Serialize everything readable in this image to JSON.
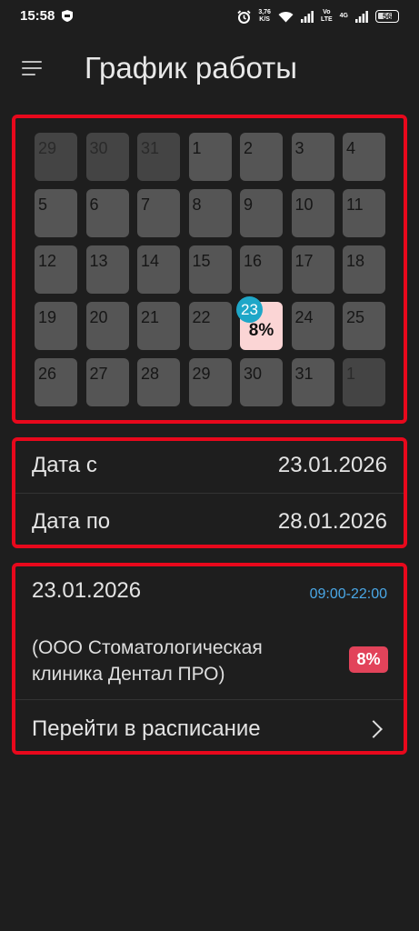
{
  "status_bar": {
    "time": "15:58",
    "speed_value": "3,76",
    "speed_unit": "K/S",
    "volte_top": "Vo",
    "volte_bottom": "LTE",
    "network": "4G",
    "battery": "56"
  },
  "header": {
    "title": "График работы"
  },
  "calendar": {
    "weeks": [
      [
        {
          "day": "29",
          "other": true
        },
        {
          "day": "30",
          "other": true
        },
        {
          "day": "31",
          "other": true
        },
        {
          "day": "1"
        },
        {
          "day": "2"
        },
        {
          "day": "3"
        },
        {
          "day": "4"
        }
      ],
      [
        {
          "day": "5"
        },
        {
          "day": "6"
        },
        {
          "day": "7"
        },
        {
          "day": "8"
        },
        {
          "day": "9"
        },
        {
          "day": "10"
        },
        {
          "day": "11"
        }
      ],
      [
        {
          "day": "12"
        },
        {
          "day": "13"
        },
        {
          "day": "14"
        },
        {
          "day": "15"
        },
        {
          "day": "16"
        },
        {
          "day": "17"
        },
        {
          "day": "18"
        }
      ],
      [
        {
          "day": "19"
        },
        {
          "day": "20"
        },
        {
          "day": "21"
        },
        {
          "day": "22"
        },
        {
          "day": "23",
          "active": true,
          "percent": "8%"
        },
        {
          "day": "24"
        },
        {
          "day": "25"
        }
      ],
      [
        {
          "day": "26"
        },
        {
          "day": "27"
        },
        {
          "day": "28"
        },
        {
          "day": "29"
        },
        {
          "day": "30"
        },
        {
          "day": "31"
        },
        {
          "day": "1",
          "other": true
        }
      ]
    ],
    "colors": {
      "day_bg": "#555555",
      "other_day_bg": "#444444",
      "active_bg": "#fbd5d5",
      "badge_bg": "#1ea7c8"
    }
  },
  "date_range": {
    "from_label": "Дата с",
    "from_value": "23.01.2026",
    "to_label": "Дата по",
    "to_value": "28.01.2026"
  },
  "shift": {
    "date": "23.01.2026",
    "time": "09:00-22:00",
    "organization": "(ООО Стоматологическая клиника Дентал ПРО)",
    "percent": "8%",
    "go_label": "Перейти в расписание"
  },
  "colors": {
    "highlight_border": "#e8081c",
    "time_text": "#4aa7e6",
    "percent_badge": "#e2435a"
  }
}
